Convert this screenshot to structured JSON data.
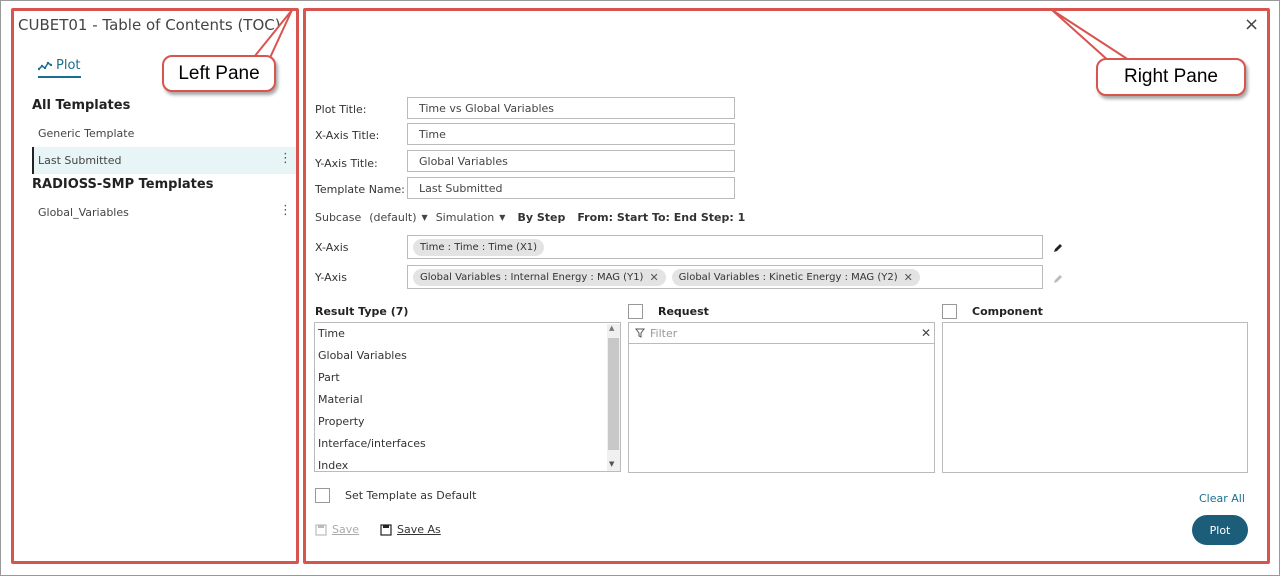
{
  "left_pane": {
    "title": "CUBET01 - Table of Contents (TOC)",
    "tab_label": "Plot",
    "all_templates_heading": "All Templates",
    "all_templates": [
      {
        "label": "Generic Template",
        "selected": false
      },
      {
        "label": "Last Submitted",
        "selected": true
      }
    ],
    "radioss_heading": "RADIOSS-SMP Templates",
    "radioss_templates": [
      {
        "label": "Global_Variables"
      }
    ]
  },
  "annotations": {
    "left_callout": "Left Pane",
    "right_callout": "Right Pane",
    "frame_color": "#d9534f"
  },
  "form": {
    "plot_title_label": "Plot Title:",
    "plot_title_value": "Time vs Global Variables",
    "x_axis_title_label": "X-Axis Title:",
    "x_axis_title_value": "Time",
    "y_axis_title_label": "Y-Axis Title:",
    "y_axis_title_value": "Global Variables",
    "template_name_label": "Template Name:",
    "template_name_value": "Last Submitted",
    "subcase_label": "Subcase",
    "subcase_value": "(default)",
    "simulation_value": "Simulation",
    "by_step": "By Step",
    "step_range": "From: Start To: End Step: 1",
    "x_axis_label": "X-Axis",
    "x_axis_chips": [
      "Time : Time : Time (X1)"
    ],
    "y_axis_label": "Y-Axis",
    "y_axis_chips": [
      "Global Variables : Internal Energy : MAG (Y1)",
      "Global Variables : Kinetic Energy : MAG (Y2)"
    ]
  },
  "result_type": {
    "heading": "Result Type",
    "count": "(7)",
    "items": [
      "Time",
      "Global Variables",
      "Part",
      "Material",
      "Property",
      "Interface/interfaces",
      "Index"
    ]
  },
  "request": {
    "heading": "Request",
    "filter_placeholder": "Filter"
  },
  "component": {
    "heading": "Component"
  },
  "footer": {
    "set_default_label": "Set Template as Default",
    "clear_all": "Clear All",
    "save": "Save",
    "save_as": "Save As",
    "plot": "Plot"
  },
  "colors": {
    "accent": "#1c5e7a",
    "tab": "#1b6f8f",
    "selected_bg": "#e8f5f7"
  },
  "close_symbol": "×"
}
